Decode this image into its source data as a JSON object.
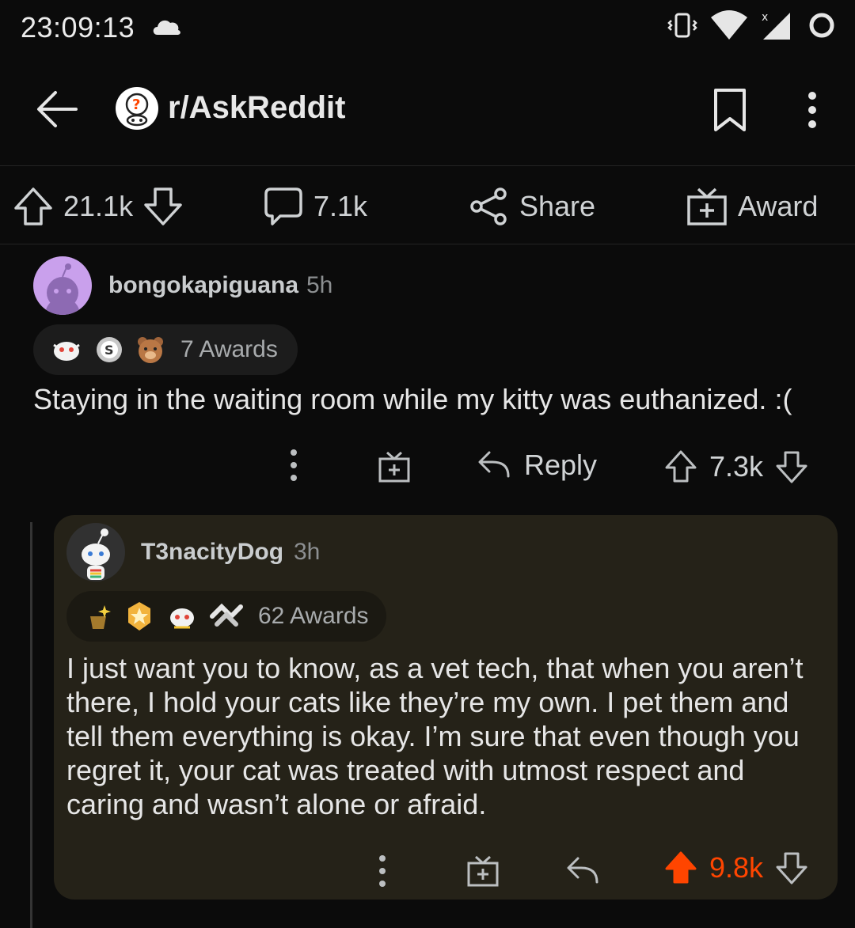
{
  "status": {
    "time": "23:09:13"
  },
  "header": {
    "subreddit": "r/AskReddit"
  },
  "post_actions": {
    "score": "21.1k",
    "comments": "7.1k",
    "share_label": "Share",
    "award_label": "Award"
  },
  "comment": {
    "username": "bongokapiguana",
    "age": "5h",
    "awards": "7 Awards",
    "body": "Staying in the waiting room while my kitty was euthanized.  :(",
    "reply_label": "Reply",
    "score": "7.3k"
  },
  "reply": {
    "username": "T3nacityDog",
    "age": "3h",
    "awards": "62 Awards",
    "body": "I just want you to know, as a vet tech, that when you aren’t there, I hold your cats like they’re my own. I pet them and tell them everything is okay. I’m sure that even though you regret it, your cat was treated with utmost respect and caring and wasn’t alone or afraid.",
    "score": "9.8k",
    "upvoted": true
  },
  "colors": {
    "upvote": "#ff4500",
    "background": "#0b0b0b",
    "card": "#252218"
  }
}
